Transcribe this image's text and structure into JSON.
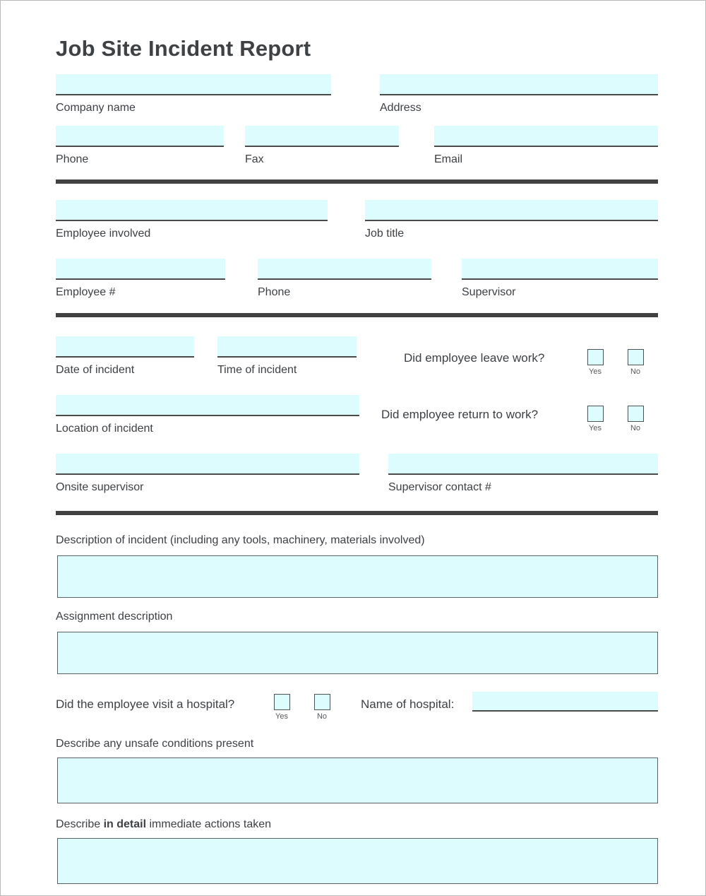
{
  "document": {
    "title": "Job Site Incident Report"
  },
  "colors": {
    "field_fill": "#ddfcfe",
    "field_underline": "#4a4a4a",
    "divider": "#414141",
    "text": "#3d4145",
    "page_border": "#b9b9b9"
  },
  "sections": {
    "company": {
      "fields": [
        {
          "label": "Company name",
          "value": ""
        },
        {
          "label": "Address",
          "value": ""
        },
        {
          "label": "Phone",
          "value": ""
        },
        {
          "label": "Fax",
          "value": ""
        },
        {
          "label": "Email",
          "value": ""
        }
      ]
    },
    "employee": {
      "fields": [
        {
          "label": "Employee involved",
          "value": ""
        },
        {
          "label": "Job title",
          "value": ""
        },
        {
          "label": "Employee #",
          "value": ""
        },
        {
          "label": "Phone",
          "value": ""
        },
        {
          "label": "Supervisor",
          "value": ""
        }
      ]
    },
    "incident": {
      "fields": [
        {
          "label": "Date of incident",
          "value": ""
        },
        {
          "label": "Time of incident",
          "value": ""
        },
        {
          "label": "Location of incident",
          "value": ""
        },
        {
          "label": "Onsite supervisor",
          "value": ""
        },
        {
          "label": "Supervisor contact #",
          "value": ""
        }
      ],
      "questions": [
        {
          "text": "Did employee leave work?",
          "options": [
            {
              "label": "Yes",
              "checked": false
            },
            {
              "label": "No",
              "checked": false
            }
          ]
        },
        {
          "text": "Did employee return to work?",
          "options": [
            {
              "label": "Yes",
              "checked": false
            },
            {
              "label": "No",
              "checked": false
            }
          ]
        }
      ]
    },
    "details": {
      "blocks": [
        {
          "label": "Description of incident (including any tools, machinery, materials involved)",
          "value": ""
        },
        {
          "label": "Assignment description",
          "value": ""
        },
        {
          "label": "Describe any unsafe conditions present",
          "value": ""
        }
      ],
      "hospital": {
        "question": "Did the employee visit a hospital?",
        "options": [
          {
            "label": "Yes",
            "checked": false
          },
          {
            "label": "No",
            "checked": false
          }
        ],
        "name_label": "Name of hospital:",
        "name_value": ""
      },
      "actions": {
        "label_prefix": "Describe ",
        "label_bold": "in detail",
        "label_suffix": " immediate actions taken",
        "value": ""
      }
    }
  }
}
